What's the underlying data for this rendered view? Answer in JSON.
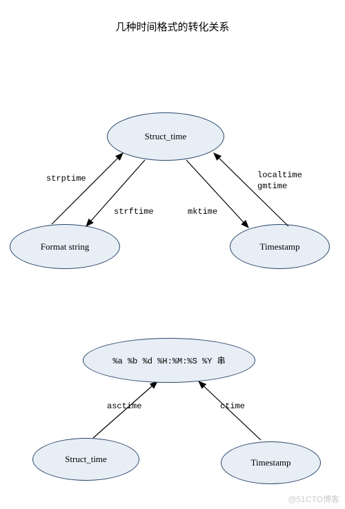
{
  "title": "几种时间格式的转化关系",
  "top": {
    "nodes": {
      "struct_time": "Struct_time",
      "format_string": "Format string",
      "timestamp": "Timestamp"
    },
    "edges": {
      "strptime": "strptime",
      "strftime": "strftime",
      "mktime": "mktime",
      "localtime_gmtime": "localtime\ngmtime"
    }
  },
  "bottom": {
    "nodes": {
      "format_str": "%a %b %d %H:%M:%S %Y 串",
      "struct_time": "Struct_time",
      "timestamp": "Timestamp"
    },
    "edges": {
      "asctime": "asctime",
      "ctime": "ctime"
    }
  },
  "watermark": "@51CTO博客"
}
